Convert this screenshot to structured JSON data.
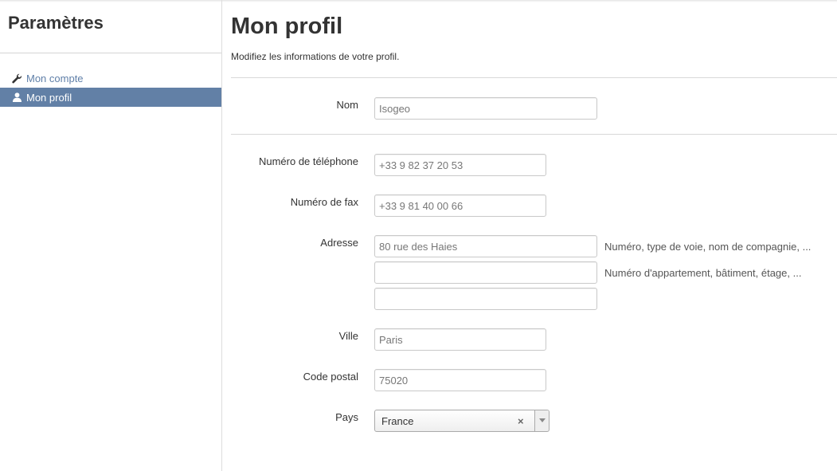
{
  "sidebar": {
    "title": "Paramètres",
    "items": [
      {
        "label": "Mon compte",
        "icon": "wrench-icon"
      },
      {
        "label": "Mon profil",
        "icon": "user-icon",
        "active": true
      }
    ]
  },
  "main": {
    "title": "Mon profil",
    "subtitle": "Modifiez les informations de votre profil."
  },
  "form": {
    "name": {
      "label": "Nom",
      "value": "Isogeo"
    },
    "phone": {
      "label": "Numéro de téléphone",
      "value": "+33 9 82 37 20 53"
    },
    "fax": {
      "label": "Numéro de fax",
      "value": "+33 9 81 40 00 66"
    },
    "address": {
      "label": "Adresse",
      "line1": "80 rue des Haies",
      "line2": "",
      "line3": "",
      "hint1": "Numéro, type de voie, nom de compagnie, ...",
      "hint2": "Numéro d'appartement, bâtiment, étage, ..."
    },
    "city": {
      "label": "Ville",
      "value": "Paris"
    },
    "postal": {
      "label": "Code postal",
      "value": "75020"
    },
    "country": {
      "label": "Pays",
      "value": "France",
      "clear": "×"
    }
  },
  "colors": {
    "accent": "#6280a6",
    "link": "#5f7fa8"
  }
}
